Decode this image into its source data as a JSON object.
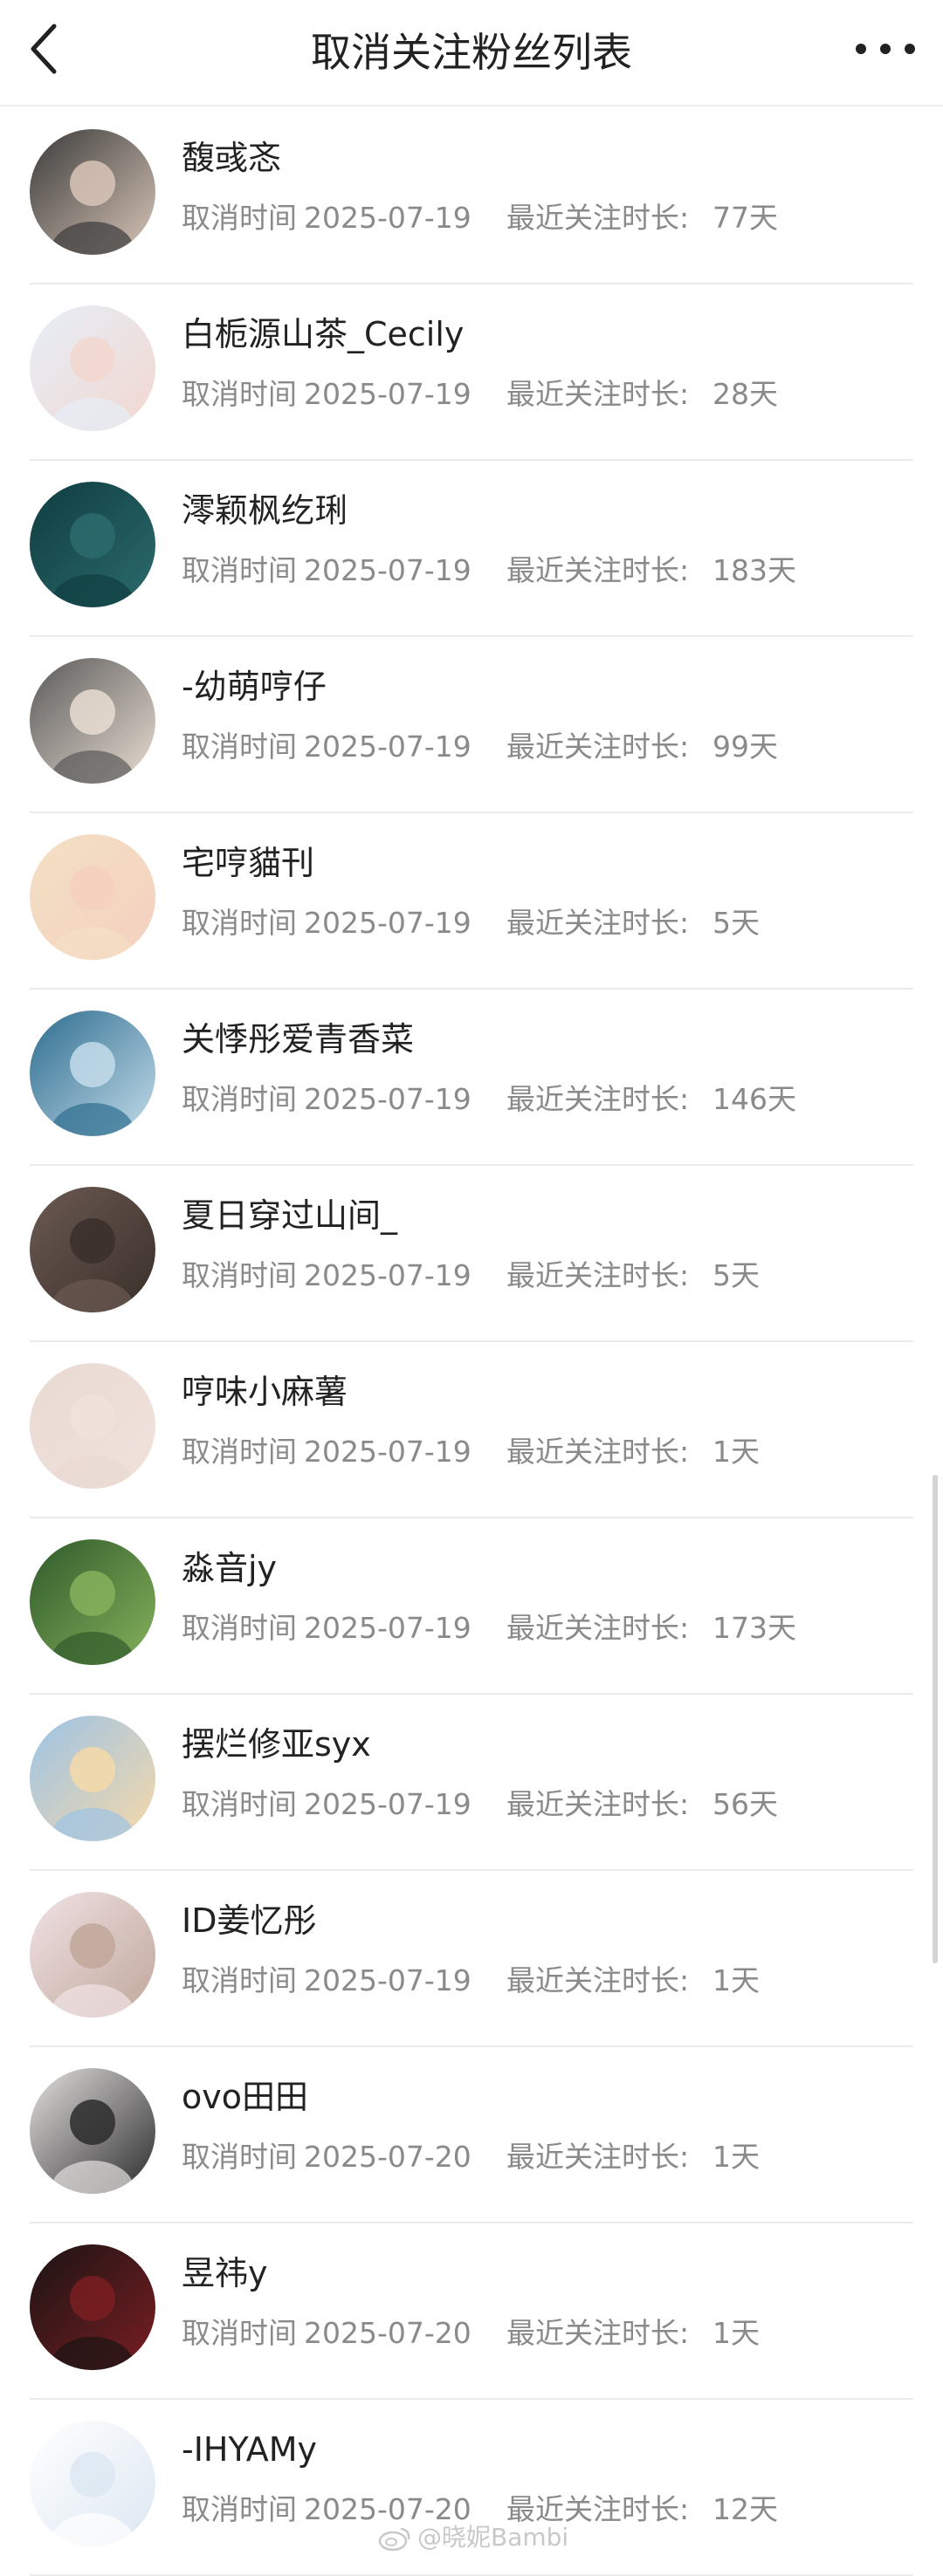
{
  "header": {
    "title": "取消关注粉丝列表",
    "back_icon": "chevron-left-icon",
    "more_icon": "more-dots-icon"
  },
  "cancel_label": "取消时间",
  "duration_label": "最近关注时长:",
  "users": [
    {
      "name": "馥彧忞",
      "cancel_date": "2025-07-19",
      "duration": "77天"
    },
    {
      "name": "白栀源山茶_Cecily",
      "cancel_date": "2025-07-19",
      "duration": "28天"
    },
    {
      "name": "澪颖枫纥琍",
      "cancel_date": "2025-07-19",
      "duration": "183天"
    },
    {
      "name": "-幼萌哼仔",
      "cancel_date": "2025-07-19",
      "duration": "99天"
    },
    {
      "name": "宅哼貓刊",
      "cancel_date": "2025-07-19",
      "duration": "5天"
    },
    {
      "name": "关悸彤爱青香菜",
      "cancel_date": "2025-07-19",
      "duration": "146天"
    },
    {
      "name": "夏日穿过山间_",
      "cancel_date": "2025-07-19",
      "duration": "5天"
    },
    {
      "name": "哼味小麻薯",
      "cancel_date": "2025-07-19",
      "duration": "1天"
    },
    {
      "name": "淼音jy",
      "cancel_date": "2025-07-19",
      "duration": "173天"
    },
    {
      "name": "摆烂修亚syx",
      "cancel_date": "2025-07-19",
      "duration": "56天"
    },
    {
      "name": "ID姜忆彤",
      "cancel_date": "2025-07-19",
      "duration": "1天"
    },
    {
      "name": "ovo田田",
      "cancel_date": "2025-07-20",
      "duration": "1天"
    },
    {
      "name": "昱祎y",
      "cancel_date": "2025-07-20",
      "duration": "1天"
    },
    {
      "name": "-IHYAMy",
      "cancel_date": "2025-07-20",
      "duration": "12天"
    }
  ],
  "watermark": {
    "text": "@晓妮Bambi",
    "icon": "weibo-icon"
  },
  "colors": {
    "title_text": "#222222",
    "meta_text": "#8a8a8a",
    "divider": "#ebebeb",
    "avatars": [
      [
        "#3a3a3a",
        "#d9c6b8"
      ],
      [
        "#e6eef8",
        "#f2d7cf"
      ],
      [
        "#0f3d40",
        "#2c6b6d"
      ],
      [
        "#5a5a5a",
        "#e9ddd2"
      ],
      [
        "#f3e0c4",
        "#f4d0bf"
      ],
      [
        "#2d6d8f",
        "#c4dcea"
      ],
      [
        "#6b5a52",
        "#3a2f2a"
      ],
      [
        "#e9d9d3",
        "#f0e3dc"
      ],
      [
        "#2f5a2b",
        "#86b25c"
      ],
      [
        "#9cc3e6",
        "#f6d9a9"
      ],
      [
        "#f1e2e5",
        "#bfa79a"
      ],
      [
        "#e4e0e0",
        "#2c2c2c"
      ],
      [
        "#1a1414",
        "#7a1e22"
      ],
      [
        "#ffffff",
        "#dde7f2"
      ]
    ]
  }
}
